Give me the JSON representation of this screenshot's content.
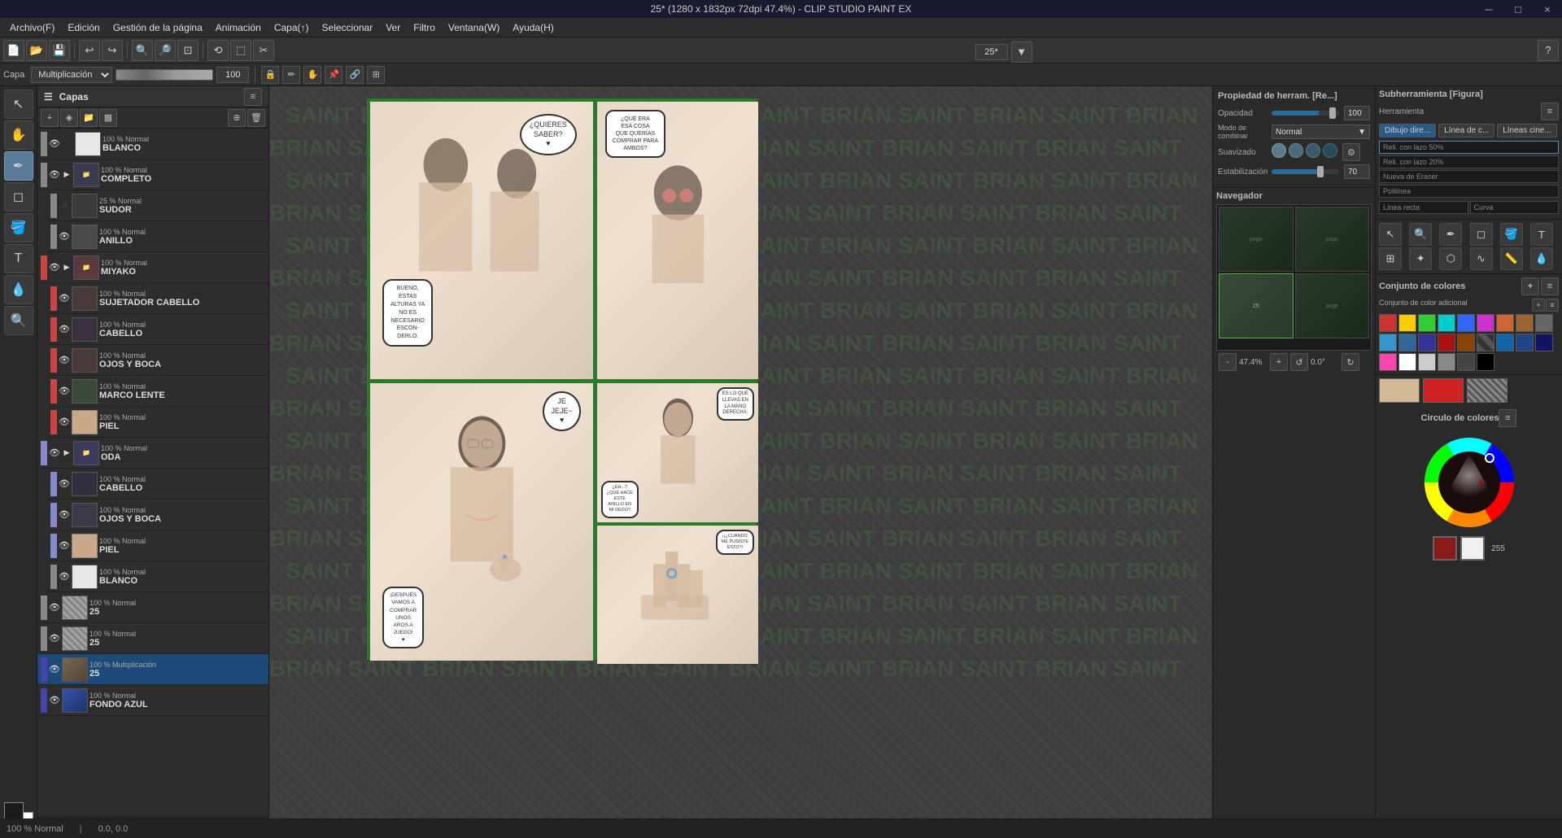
{
  "title": "25* (1280 x 1832px 72dpi 47.4%) - CLIP STUDIO PAINT EX",
  "win_controls": {
    "minimize": "─",
    "maximize": "□",
    "close": "×"
  },
  "menu": {
    "items": [
      "Archivo(F)",
      "Edición",
      "Gestión de la página",
      "Animación",
      "Capa(↑)",
      "Seleccionar",
      "Ver",
      "Filtro",
      "Ventana(W)",
      "Ayuda(H)"
    ]
  },
  "toolbar2": {
    "layer_label": "Capa",
    "blend_mode": "Multiplicación",
    "opacity": "100"
  },
  "zoom": {
    "value": "25*"
  },
  "layers": [
    {
      "id": 1,
      "mode": "100 % Normal",
      "name": "BLANCO",
      "visible": true,
      "locked": false,
      "color": "#e8e8e8",
      "thumb": "white",
      "indent": 0,
      "active": false
    },
    {
      "id": 2,
      "mode": "100 % Normal",
      "name": "COMPLETO",
      "visible": true,
      "locked": false,
      "color": "#888",
      "thumb": "folder",
      "indent": 0,
      "active": false
    },
    {
      "id": 3,
      "mode": "25 % Normal",
      "name": "SUDOR",
      "visible": false,
      "locked": false,
      "color": "#888",
      "thumb": "img",
      "indent": 1,
      "active": false
    },
    {
      "id": 4,
      "mode": "100 % Normal",
      "name": "ANILLO",
      "visible": true,
      "locked": false,
      "color": "#888",
      "thumb": "img",
      "indent": 1,
      "active": false
    },
    {
      "id": 5,
      "mode": "100 % Normal",
      "name": "MIYAKO",
      "visible": true,
      "locked": false,
      "color": "#c44",
      "thumb": "folder",
      "indent": 0,
      "active": false
    },
    {
      "id": 6,
      "mode": "100 % Normal",
      "name": "SUJETADOR CABELLO",
      "visible": true,
      "locked": false,
      "color": "#c44",
      "thumb": "img",
      "indent": 1,
      "active": false
    },
    {
      "id": 7,
      "mode": "100 % Normal",
      "name": "CABELLO",
      "visible": true,
      "locked": false,
      "color": "#c44",
      "thumb": "img",
      "indent": 1,
      "active": false
    },
    {
      "id": 8,
      "mode": "100 % Normal",
      "name": "OJOS Y BOCA",
      "visible": true,
      "locked": false,
      "color": "#c44",
      "thumb": "img",
      "indent": 1,
      "active": false
    },
    {
      "id": 9,
      "mode": "100 % Normal",
      "name": "MARCO LENTE",
      "visible": true,
      "locked": false,
      "color": "#c44",
      "thumb": "img",
      "indent": 1,
      "active": false
    },
    {
      "id": 10,
      "mode": "100 % Normal",
      "name": "PIEL",
      "visible": true,
      "locked": false,
      "color": "#c44",
      "thumb": "img",
      "indent": 1,
      "active": false
    },
    {
      "id": 11,
      "mode": "100 % Normal",
      "name": "ODA",
      "visible": true,
      "locked": false,
      "color": "#88c",
      "thumb": "folder",
      "indent": 0,
      "active": false
    },
    {
      "id": 12,
      "mode": "100 % Normal",
      "name": "CABELLO",
      "visible": true,
      "locked": false,
      "color": "#88c",
      "thumb": "img",
      "indent": 1,
      "active": false
    },
    {
      "id": 13,
      "mode": "100 % Normal",
      "name": "OJOS Y BOCA",
      "visible": true,
      "locked": false,
      "color": "#88c",
      "thumb": "img",
      "indent": 1,
      "active": false
    },
    {
      "id": 14,
      "mode": "100 % Normal",
      "name": "PIEL",
      "visible": true,
      "locked": false,
      "color": "#88c",
      "thumb": "img",
      "indent": 1,
      "active": false
    },
    {
      "id": 15,
      "mode": "100 % Normal",
      "name": "BLANCO",
      "visible": true,
      "locked": false,
      "color": "#888",
      "thumb": "img",
      "indent": 1,
      "active": false
    },
    {
      "id": 16,
      "mode": "100 % Normal",
      "name": "25",
      "visible": true,
      "locked": false,
      "color": "#888",
      "thumb": "img",
      "indent": 0,
      "active": false
    },
    {
      "id": 17,
      "mode": "100 % Normal",
      "name": "25",
      "visible": true,
      "locked": false,
      "color": "#888",
      "thumb": "img",
      "indent": 0,
      "active": false
    },
    {
      "id": 18,
      "mode": "100 % Multiplicación",
      "name": "25",
      "visible": true,
      "locked": false,
      "color": "#44a",
      "thumb": "img",
      "indent": 0,
      "active": true,
      "selected": true
    },
    {
      "id": 19,
      "mode": "100 % Normal",
      "name": "FONDO AZUL",
      "visible": true,
      "locked": false,
      "color": "#44a",
      "thumb": "img",
      "indent": 0,
      "active": false
    },
    {
      "id": 20,
      "mode": "100 % Normal",
      "name": "",
      "visible": true,
      "locked": false,
      "color": "#888",
      "thumb": "img",
      "indent": 0,
      "active": false
    }
  ],
  "properties": {
    "header": "Propiedad de herram. [Re...]",
    "opacity_label": "Opacidad",
    "opacity_value": "100",
    "blend_label": "Modo de combinar",
    "blend_value": "Normal",
    "smooth_label": "Suavizado",
    "stabilize_label": "Estabilización",
    "stabilize_value": "70"
  },
  "navigator": {
    "header": "Navegador",
    "zoom": "47.4%",
    "angle": "0.0°"
  },
  "color_set": {
    "header": "Conjunto de colores",
    "sub_header": "Conjunto de color adicional",
    "swatches": [
      "#cc3333",
      "#ffcc00",
      "#33cc33",
      "#00cccc",
      "#3366ff",
      "#cc33cc",
      "#cc6633",
      "#996633",
      "#666666",
      "#3399cc",
      "#336699",
      "#333399",
      "#cc1111",
      "#994400",
      "#444444",
      "#1166aa",
      "#224488",
      "#111166",
      "#ff44aa",
      "#ffffff",
      "#cccccc",
      "#888888",
      "#444444",
      "#000000"
    ]
  },
  "subtool": {
    "header": "Subherramienta [Figura]",
    "tool_label": "Herramienta",
    "options": [
      {
        "label": "Dibujo dire...",
        "active": true
      },
      {
        "label": "Línea de c...",
        "active": false
      },
      {
        "label": "Líneas cine...",
        "active": false
      }
    ],
    "line_options": [
      {
        "label": "Reli. con lazo 50%",
        "active": true
      },
      {
        "label": "Reli. con lazo 20%",
        "active": false
      },
      {
        "label": "Nueva de Eraser",
        "active": false
      },
      {
        "label": "Polilinea",
        "active": false
      },
      {
        "label": "Línea recta",
        "active": false
      },
      {
        "label": "Curva",
        "active": false
      }
    ]
  },
  "color_circle": {
    "header": "Circulo de colores",
    "r": "255",
    "selected_color": "#8B1A1A"
  },
  "status_bar": {
    "zoom_mode": "100 % Normal",
    "info": ""
  },
  "canvas_zoom": "25*",
  "watermark": "SAINT BRIAN"
}
